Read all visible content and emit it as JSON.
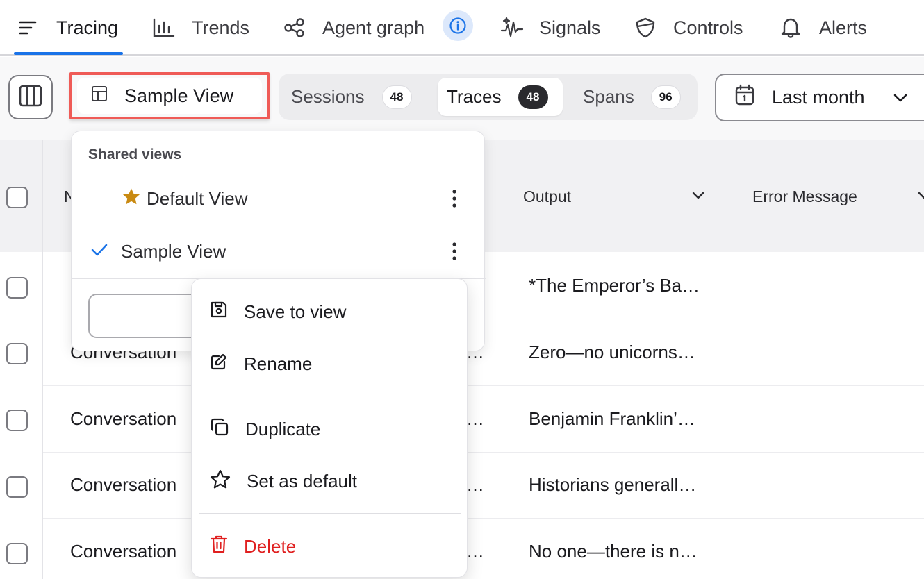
{
  "nav": {
    "tabs": [
      {
        "label": "Tracing",
        "icon": "menu-lines-icon",
        "active": true
      },
      {
        "label": "Trends",
        "icon": "bar-chart-icon"
      },
      {
        "label": "Agent graph",
        "icon": "graph-nodes-icon"
      },
      {
        "label": "Signals",
        "icon": "sparkle-wave-icon"
      },
      {
        "label": "Controls",
        "icon": "shield-icon"
      },
      {
        "label": "Alerts",
        "icon": "bell-icon"
      }
    ],
    "info_icon": "info-icon"
  },
  "toolbar": {
    "view_button_label": "Sample View",
    "segments": [
      {
        "label": "Sessions",
        "count": "48",
        "active": false
      },
      {
        "label": "Traces",
        "count": "48",
        "active": true
      },
      {
        "label": "Spans",
        "count": "96",
        "active": false
      }
    ],
    "date_range_label": "Last month"
  },
  "table": {
    "headers": {
      "name_partial": "N",
      "output": "Output",
      "error_message": "Error Message"
    },
    "rows": [
      {
        "name": "",
        "output": "*The Emperor’s Ba…"
      },
      {
        "name": "Conversation",
        "output": "Zero—no unicorns…"
      },
      {
        "name": "Conversation",
        "output": "Benjamin Franklin’…"
      },
      {
        "name": "Conversation",
        "output": "Historians generall…"
      },
      {
        "name": "Conversation",
        "output": "No one—there is n…"
      }
    ],
    "hidden_ellipsis": "…"
  },
  "views_menu": {
    "header": "Shared views",
    "items": [
      {
        "label": "Default View",
        "icon": "star-filled-icon",
        "is_default": true
      },
      {
        "label": "Sample View",
        "icon": "check-icon",
        "selected": true
      }
    ]
  },
  "context_menu": {
    "items": [
      {
        "label": "Save to view",
        "icon": "save-icon"
      },
      {
        "label": "Rename",
        "icon": "pencil-icon"
      },
      {
        "label": "Duplicate",
        "icon": "duplicate-icon"
      },
      {
        "label": "Set as default",
        "icon": "star-outline-icon"
      },
      {
        "label": "Delete",
        "icon": "trash-icon",
        "danger": true
      }
    ]
  },
  "colors": {
    "accent": "#1a73e8",
    "highlight": "#ef5b57",
    "danger": "#e02020",
    "star": "#c98a12"
  }
}
